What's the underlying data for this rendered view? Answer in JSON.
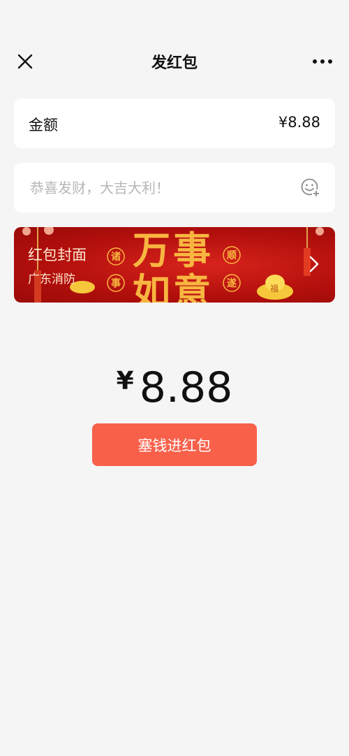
{
  "header": {
    "title": "发红包",
    "close_icon": "close-icon",
    "more_icon": "more-icon"
  },
  "amount": {
    "label": "金额",
    "value": "¥8.88"
  },
  "message": {
    "placeholder": "恭喜发财，大吉大利！",
    "value": "",
    "emoji_icon": "emoji-add-icon"
  },
  "cover": {
    "title": "红包封面",
    "subtitle": "广东消防",
    "art_big_chars": [
      "万",
      "事",
      "如",
      "意"
    ],
    "art_circle_chars": [
      "诸",
      "事",
      "顺",
      "遂"
    ],
    "art_ingot_char": "福",
    "arrow_icon": "chevron-right-icon"
  },
  "total": {
    "symbol": "¥",
    "value": "8.88"
  },
  "submit": {
    "label": "塞钱进红包"
  },
  "colors": {
    "background": "#f5f5f5",
    "card": "#ffffff",
    "primary_button": "#f8604a",
    "cover_red": "#c3150f",
    "cover_gold": "#f8b640"
  }
}
